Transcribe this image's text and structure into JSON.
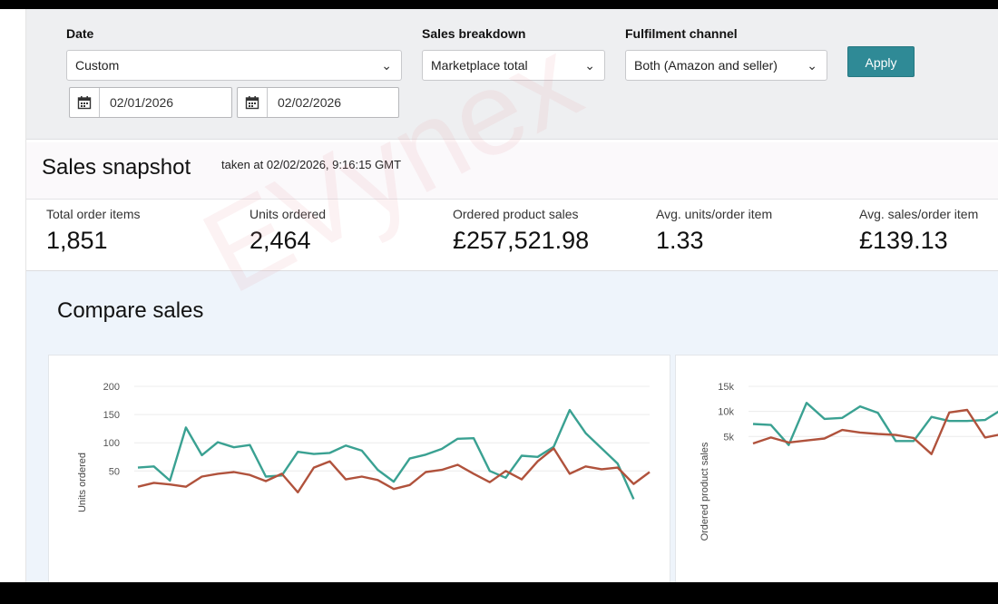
{
  "filters": {
    "date": {
      "label": "Date",
      "value": "Custom"
    },
    "start_date": "02/01/2026",
    "end_date": "02/02/2026",
    "breakdown": {
      "label": "Sales breakdown",
      "value": "Marketplace total"
    },
    "fulfilment": {
      "label": "Fulfilment channel",
      "value": "Both (Amazon and seller)"
    },
    "apply_label": "Apply"
  },
  "snapshot": {
    "title": "Sales snapshot",
    "taken": "taken at 02/02/2026, 9:16:15 GMT",
    "metrics": [
      {
        "label": "Total order items",
        "value": "1,851"
      },
      {
        "label": "Units ordered",
        "value": "2,464"
      },
      {
        "label": "Ordered product sales",
        "value": "£257,521.98"
      },
      {
        "label": "Avg. units/order item",
        "value": "1.33"
      },
      {
        "label": "Avg. sales/order item",
        "value": "£139.13"
      }
    ]
  },
  "compare": {
    "title": "Compare sales"
  },
  "watermark": "EVynex",
  "colors": {
    "accent": "#2f8a96",
    "teal_series": "#3aa192",
    "red_series": "#b0523c"
  },
  "chart_data": [
    {
      "type": "line",
      "ylabel": "Units ordered",
      "ylim": [
        0,
        200
      ],
      "yticks": [
        {
          "value": 50,
          "label": "50"
        },
        {
          "value": 100,
          "label": "100"
        },
        {
          "value": 150,
          "label": "150"
        },
        {
          "value": 200,
          "label": "200"
        }
      ],
      "series": [
        {
          "values": [
            56,
            58,
            33,
            127,
            78,
            101,
            92,
            96,
            40,
            42,
            84,
            80,
            82,
            95,
            86,
            52,
            31,
            72,
            79,
            89,
            107,
            108,
            50,
            38,
            77,
            75,
            93,
            158,
            117,
            90,
            63,
            0
          ]
        },
        {
          "values": [
            22,
            29,
            26,
            22,
            40,
            45,
            48,
            43,
            32,
            45,
            12,
            56,
            67,
            35,
            40,
            34,
            18,
            25,
            48,
            52,
            61,
            45,
            30,
            50,
            35,
            67,
            90,
            45,
            58,
            53,
            56,
            27,
            48
          ]
        }
      ],
      "grid": true
    },
    {
      "type": "line",
      "ylabel": "Ordered product sales",
      "ylim": [
        0,
        15000
      ],
      "yticks": [
        {
          "value": 5000,
          "label": "5k"
        },
        {
          "value": 10000,
          "label": "10k"
        },
        {
          "value": 15000,
          "label": "15k"
        }
      ],
      "series": [
        {
          "values": [
            7500,
            7300,
            3300,
            11700,
            8500,
            8700,
            11000,
            9700,
            4100,
            4100,
            8900,
            8100,
            8100,
            8300,
            10500,
            8800
          ]
        },
        {
          "values": [
            3600,
            4800,
            3800,
            4200,
            4600,
            6300,
            5800,
            5500,
            5300,
            4700,
            1500,
            9800,
            10300,
            4800,
            5500,
            4600
          ]
        }
      ],
      "grid": true
    }
  ]
}
